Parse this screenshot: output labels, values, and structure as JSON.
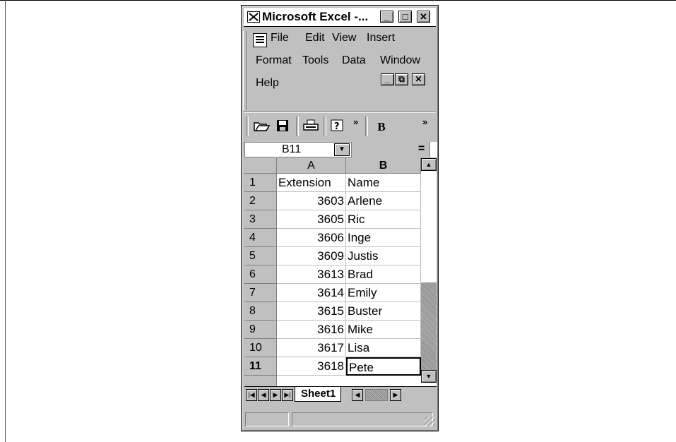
{
  "window": {
    "title": "Microsoft Excel -...",
    "minimize": "_",
    "maximize": "□",
    "close": "✕"
  },
  "menu": {
    "items": [
      "File",
      "Edit",
      "View",
      "Insert",
      "Format",
      "Tools",
      "Data",
      "Window",
      "Help"
    ],
    "doc_minimize": "_",
    "doc_restore": "⧉",
    "doc_close": "✕"
  },
  "toolbar": {
    "open_icon": "open-folder-icon",
    "save_icon": "save-disk-icon",
    "print_icon": "printer-icon",
    "help_icon": "help-question-icon",
    "help_glyph": "?",
    "more_glyph": "»",
    "bold_label": "B"
  },
  "formula_bar": {
    "name_box": "B11",
    "equals": "="
  },
  "sheet": {
    "columns": [
      "A",
      "B"
    ],
    "rows": [
      {
        "row": "1",
        "a": "Extension",
        "b": "Name"
      },
      {
        "row": "2",
        "a": "3603",
        "b": "Arlene"
      },
      {
        "row": "3",
        "a": "3605",
        "b": "Ric"
      },
      {
        "row": "4",
        "a": "3606",
        "b": "Inge"
      },
      {
        "row": "5",
        "a": "3609",
        "b": "Justis"
      },
      {
        "row": "6",
        "a": "3613",
        "b": "Brad"
      },
      {
        "row": "7",
        "a": "3614",
        "b": "Emily"
      },
      {
        "row": "8",
        "a": "3615",
        "b": "Buster"
      },
      {
        "row": "9",
        "a": "3616",
        "b": "Mike"
      },
      {
        "row": "10",
        "a": "3617",
        "b": "Lisa"
      },
      {
        "row": "11",
        "a": "3618",
        "b": "Pete"
      }
    ],
    "active_cell": "B11"
  },
  "tabs": {
    "sheet_label": "Sheet1"
  }
}
